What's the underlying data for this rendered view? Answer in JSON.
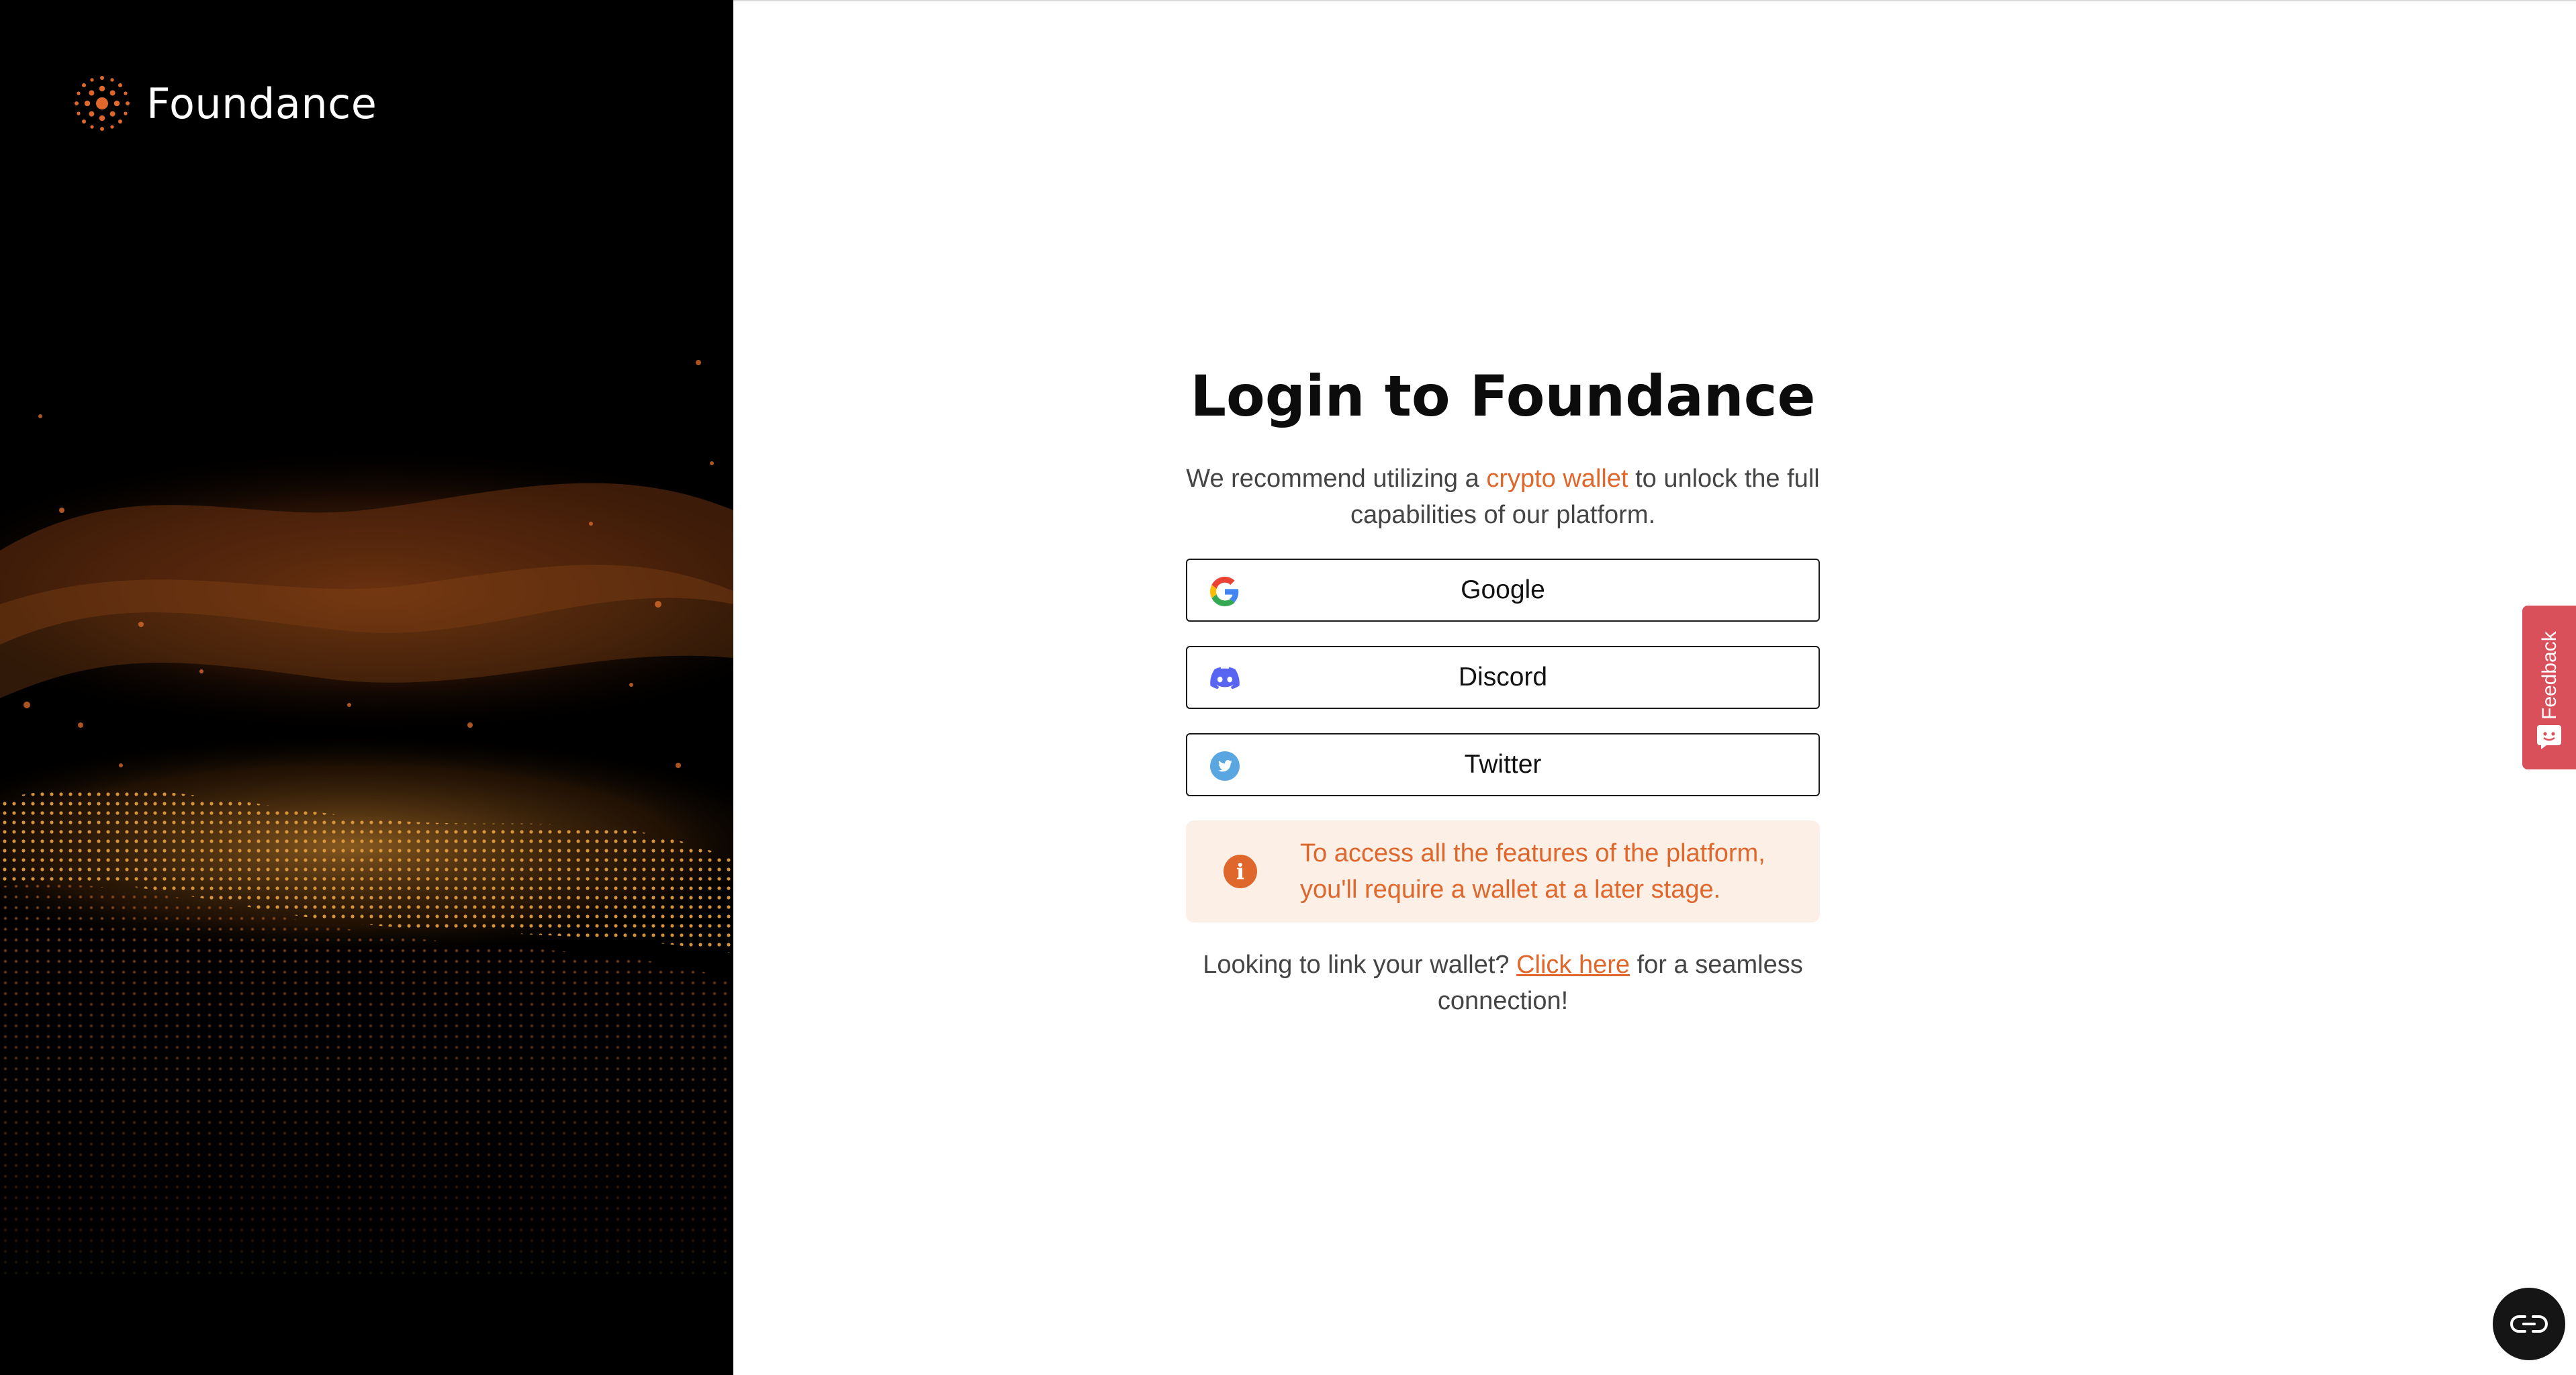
{
  "brand": {
    "name": "Foundance",
    "accent_color": "#e0672b",
    "logo_icon": "sunburst-logo-icon"
  },
  "login": {
    "title": "Login to Foundance",
    "subtitle_prefix": "We recommend utilizing a ",
    "subtitle_link": "crypto wallet",
    "subtitle_suffix": " to unlock the full capabilities of our platform.",
    "buttons": [
      {
        "label": "Google",
        "icon": "google-icon"
      },
      {
        "label": "Discord",
        "icon": "discord-icon"
      },
      {
        "label": "Twitter",
        "icon": "twitter-icon"
      }
    ],
    "notice": "To access all the features of the platform, you'll require a wallet at a later stage.",
    "wallet_prefix": "Looking to link your wallet? ",
    "wallet_link": "Click here",
    "wallet_suffix": " for a seamless connection!"
  },
  "feedback": {
    "label": "Feedback",
    "color": "#d9505b"
  },
  "chat": {
    "icon": "chat-link-icon"
  }
}
